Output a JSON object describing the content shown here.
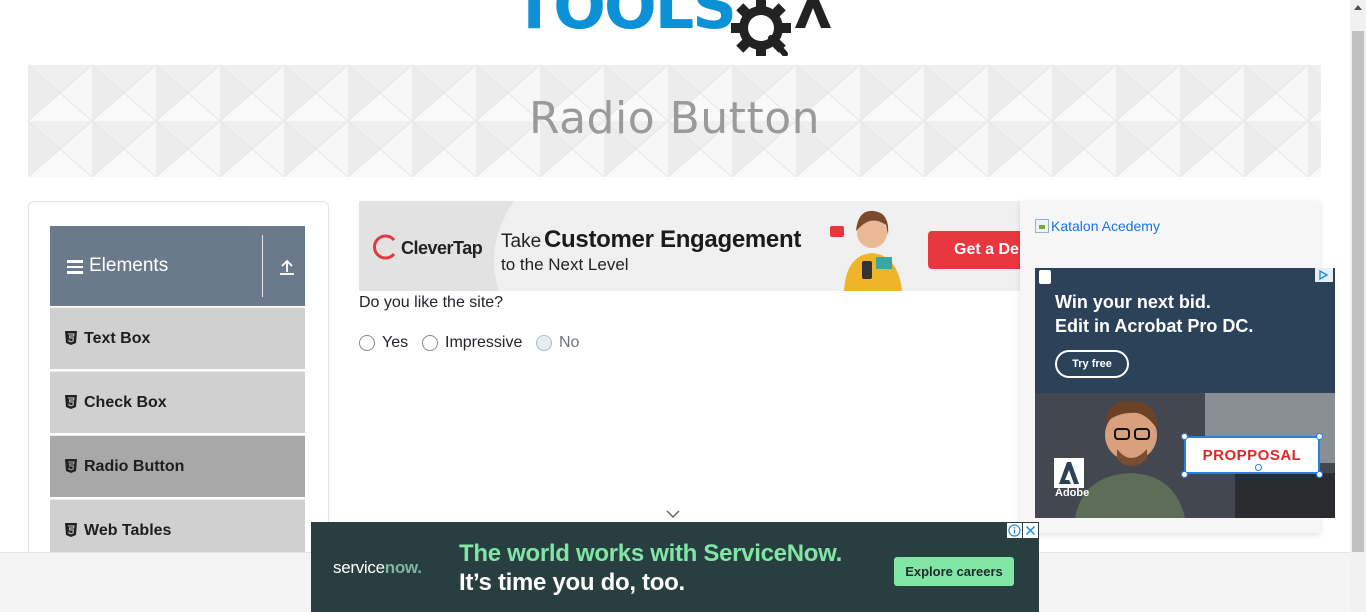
{
  "logo": {
    "text_tools": "TOOLS",
    "text_qa": "QA"
  },
  "page": {
    "title": "Radio Button"
  },
  "sidebar": {
    "group": {
      "label": "Elements"
    },
    "items": [
      {
        "label": "Text Box",
        "active": false
      },
      {
        "label": "Check Box",
        "active": false
      },
      {
        "label": "Radio Button",
        "active": true
      },
      {
        "label": "Web Tables",
        "active": false
      }
    ]
  },
  "ads": {
    "top": {
      "brand": "CleverTap",
      "take": "Take",
      "headline": "Customer Engagement",
      "sub": "to the Next Level",
      "cta": "Get a Demo"
    },
    "katalon": {
      "alt": "Katalon Acedemy"
    },
    "adobe": {
      "headline_1": "Win your next bid.",
      "headline_2": "Edit in Acrobat Pro DC.",
      "cta": "Try free",
      "proposal": "PROPPOSAL",
      "brand": "Adobe"
    },
    "bottom": {
      "brand_prefix": "service",
      "brand_suffix": "now.",
      "line_1": "The world works with ServiceNow.",
      "line_2": "It’s time you do, too.",
      "cta": "Explore careers"
    }
  },
  "form": {
    "question": "Do you like the site?",
    "options": [
      {
        "label": "Yes",
        "disabled": false,
        "checked": false
      },
      {
        "label": "Impressive",
        "disabled": false,
        "checked": false
      },
      {
        "label": "No",
        "disabled": true,
        "checked": false
      }
    ]
  },
  "colors": {
    "brand_blue": "#0d91d6",
    "sidebar_header": "#6b7a8a",
    "menu_item": "#d0d0d0",
    "menu_item_active": "#a8a8a8",
    "servicenow_green": "#81e6a4"
  }
}
